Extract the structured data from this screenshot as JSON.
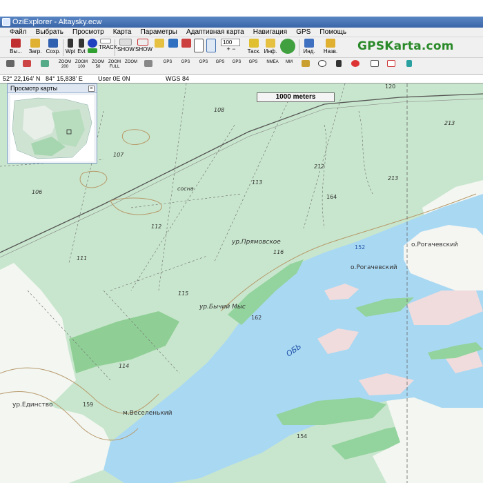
{
  "window": {
    "title": "OziExplorer - Altaysky.ecw"
  },
  "menu": [
    "Файл",
    "Выбрать",
    "Просмотр",
    "Карта",
    "Параметры",
    "Адаптивная карта",
    "Навигация",
    "GPS",
    "Помощь"
  ],
  "toolbar": {
    "exit": "Вы...",
    "load": "Загр.",
    "save": "Сохр.",
    "wpt": "Wpt",
    "evt": "Evt",
    "track": "TRACK",
    "show": "SHOW",
    "zoom_value": "100",
    "task": "Таск.",
    "info": "Инф.",
    "ind": "Инд.",
    "back": "Назв."
  },
  "toolbar2": {
    "zoom200": "ZOOM 200",
    "zoom100": "ZOOM 100",
    "zoom50": "ZOOM 50",
    "zoomfull": "ZOOM FULL",
    "zoom": "ZOOM",
    "gps": "GPS",
    "nmea": "NMEA",
    "mm": "MM"
  },
  "brand": "GPSKarta.com",
  "status": {
    "lat": "52° 22,164' N",
    "lon": "84° 15,838' E",
    "user": "User  0E   0N",
    "datum": "WGS 84"
  },
  "overview": {
    "title": "Просмотр карты",
    "close": "×"
  },
  "scale": "1000 meters",
  "map_labels": {
    "l108": "108",
    "l107": "107",
    "l106": "106",
    "l113": "113",
    "l112": "112",
    "l111": "111",
    "l115": "115",
    "l116": "116",
    "l114": "114",
    "l164": "164",
    "l162": "162",
    "l159": "159",
    "l154": "154",
    "l152": "152",
    "l212": "212",
    "l213a": "213",
    "l213b": "213",
    "l120": "120",
    "sosna": "сосна",
    "pryamovskoe": "ур.Прямовское",
    "bychiy": "ур.Бычий Мыс",
    "rogachevskiy1": "о.Рогачевский",
    "rogachevskiy2": "о.Рогачевский",
    "edinstvo": "ур.Единство",
    "veselenkiy": "м.Веселенький",
    "river": "ОБЬ"
  }
}
